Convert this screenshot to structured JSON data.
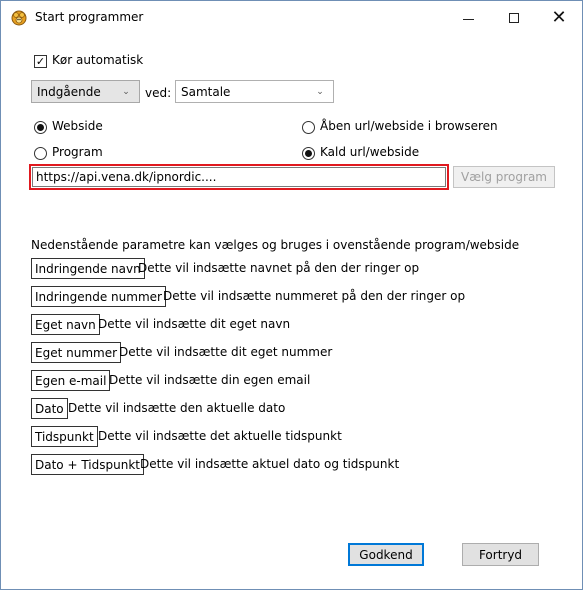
{
  "window": {
    "title": "Start programmer",
    "controls": {
      "minimize": "minimize",
      "maximize": "maximize",
      "close": "✕"
    }
  },
  "auto_start": {
    "label": "Kør automatisk",
    "checked": true
  },
  "trigger": {
    "direction_value": "Indgående",
    "ved_label": "ved:",
    "event_value": "Samtale"
  },
  "mode": {
    "webside_label": "Webside",
    "program_label": "Program",
    "webside_checked": true,
    "open_url_label": "Åben url/webside i browseren",
    "call_url_label": "Kald url/webside",
    "call_url_checked": true
  },
  "url": {
    "value": "https://api.vena.dk/ipnordic...."
  },
  "choose_program_label": "Vælg program",
  "params": {
    "intro": "Nedenstående parametre kan vælges og bruges i ovenstående program/webside",
    "items": [
      {
        "tag": "Indringende navn",
        "desc": "Dette vil indsætte navnet på den der ringer op"
      },
      {
        "tag": "Indringende nummer",
        "desc": "Dette vil indsætte nummeret på den der ringer op"
      },
      {
        "tag": "Eget navn",
        "desc": "Dette vil indsætte dit eget navn"
      },
      {
        "tag": "Eget nummer",
        "desc": "Dette vil indsætte dit eget nummer"
      },
      {
        "tag": "Egen e-mail",
        "desc": "Dette vil indsætte din egen email"
      },
      {
        "tag": "Dato",
        "desc": "Dette vil indsætte den aktuelle dato"
      },
      {
        "tag": "Tidspunkt",
        "desc": "Dette vil indsætte det aktuelle tidspunkt"
      },
      {
        "tag": "Dato + Tidspunkt",
        "desc": "Dette vil indsætte aktuel dato og tidspunkt"
      }
    ]
  },
  "buttons": {
    "ok": "Godkend",
    "cancel": "Fortryd"
  },
  "colors": {
    "highlight_border": "#e0191f",
    "default_button_border": "#0078d7"
  }
}
